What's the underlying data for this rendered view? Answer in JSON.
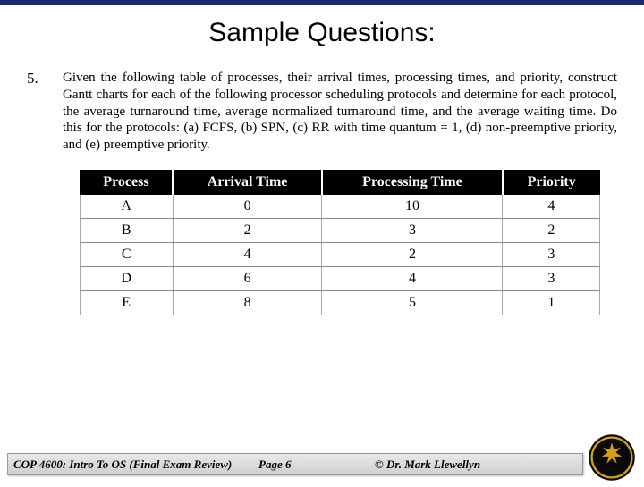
{
  "title": "Sample Questions:",
  "question": {
    "number": "5.",
    "text": "Given the following table of processes, their arrival times, processing times, and priority, construct Gantt charts for each of the following processor scheduling protocols and determine for each protocol, the average turnaround time, average normalized turnaround time, and the average waiting time.   Do this for the protocols: (a) FCFS, (b) SPN, (c) RR with time quantum = 1, (d) non-preemptive priority, and (e) preemptive priority."
  },
  "table": {
    "headers": [
      "Process",
      "Arrival Time",
      "Processing Time",
      "Priority"
    ],
    "rows": [
      {
        "c0": "A",
        "c1": "0",
        "c2": "10",
        "c3": "4"
      },
      {
        "c0": "B",
        "c1": "2",
        "c2": "3",
        "c3": "2"
      },
      {
        "c0": "C",
        "c1": "4",
        "c2": "2",
        "c3": "3"
      },
      {
        "c0": "D",
        "c1": "6",
        "c2": "4",
        "c3": "3"
      },
      {
        "c0": "E",
        "c1": "8",
        "c2": "5",
        "c3": "1"
      }
    ]
  },
  "chart_data": {
    "type": "table",
    "columns": [
      "Process",
      "Arrival Time",
      "Processing Time",
      "Priority"
    ],
    "rows": [
      [
        "A",
        0,
        10,
        4
      ],
      [
        "B",
        2,
        3,
        2
      ],
      [
        "C",
        4,
        2,
        3
      ],
      [
        "D",
        6,
        4,
        3
      ],
      [
        "E",
        8,
        5,
        1
      ]
    ]
  },
  "footer": {
    "course": "COP 4600: Intro To OS  (Final Exam Review)",
    "page": "Page 6",
    "author": "© Dr. Mark Llewellyn"
  }
}
